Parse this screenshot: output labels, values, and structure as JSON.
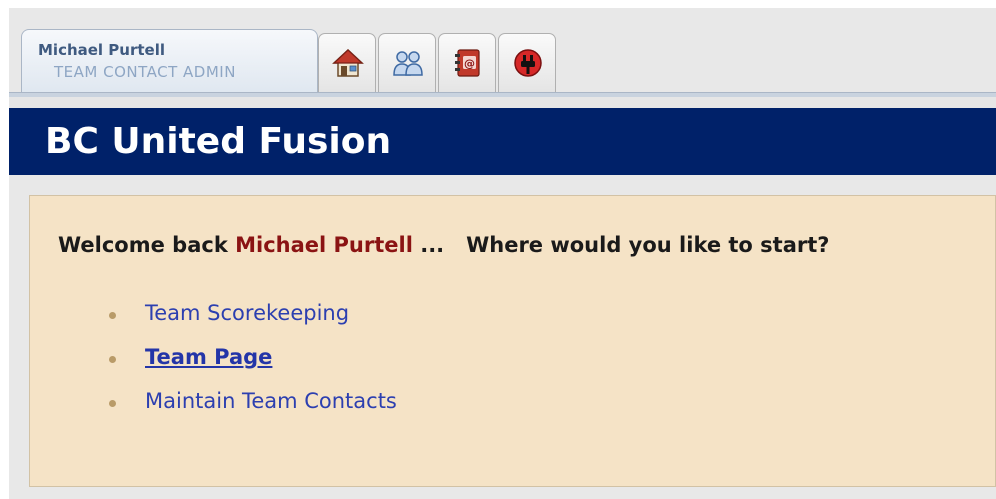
{
  "user": {
    "name": "Michael Purtell",
    "role": "TEAM CONTACT ADMIN"
  },
  "tabs": [
    {
      "icon": "home-icon"
    },
    {
      "icon": "users-icon"
    },
    {
      "icon": "address-book-icon"
    },
    {
      "icon": "logout-plug-icon"
    }
  ],
  "header": {
    "title": "BC United Fusion"
  },
  "welcome": {
    "prefix": "Welcome back ",
    "name": "Michael Purtell",
    "suffix": " ...   Where would you like to start?"
  },
  "links": [
    {
      "label": "Team Scorekeeping",
      "active": false
    },
    {
      "label": "Team Page",
      "active": true
    },
    {
      "label": "Maintain Team Contacts",
      "active": false
    }
  ],
  "colors": {
    "header_bg": "#002169",
    "content_bg": "#f5e3c6",
    "user_name_color": "#8a1313",
    "link": "#2c3fb0"
  }
}
